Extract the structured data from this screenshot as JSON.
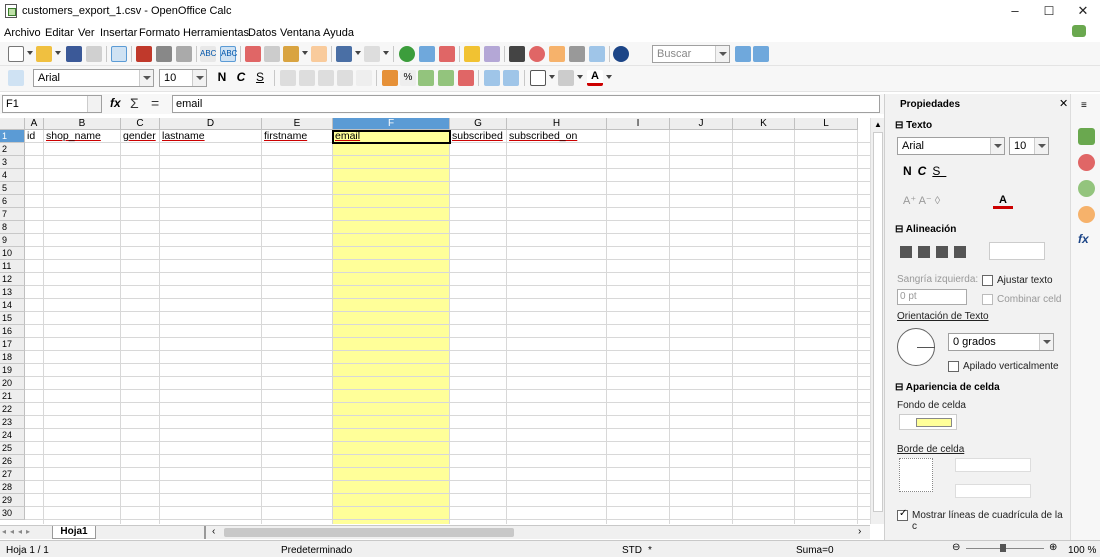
{
  "window": {
    "title": "customers_export_1.csv - OpenOffice Calc",
    "minimize": "–",
    "maximize": "☐",
    "close": "✕"
  },
  "menu": [
    "Archivo",
    "Editar",
    "Ver",
    "Insertar",
    "Formato",
    "Herramientas",
    "Datos",
    "Ventana",
    "Ayuda"
  ],
  "toolbar": {
    "search_placeholder": "Buscar",
    "font_name": "Arial",
    "font_size": "10",
    "bold": "N",
    "italic": "C",
    "underline": "S"
  },
  "formula_bar": {
    "cell_ref": "F1",
    "fx": "fx",
    "sum": "Σ",
    "equals": "=",
    "content": "email"
  },
  "grid": {
    "columns": [
      "A",
      "B",
      "C",
      "D",
      "E",
      "F",
      "G",
      "H",
      "I",
      "J",
      "K",
      "L"
    ],
    "rows": [
      "1",
      "2",
      "3",
      "4",
      "5",
      "6",
      "7",
      "8",
      "9",
      "10",
      "11",
      "12",
      "13",
      "14",
      "15",
      "16",
      "17",
      "18",
      "19",
      "20",
      "21",
      "22",
      "23",
      "24",
      "25",
      "26",
      "27",
      "28",
      "29",
      "30"
    ],
    "row1": [
      "id",
      "shop_name",
      "gender",
      "lastname",
      "firstname",
      "email",
      "subscribed",
      "subscribed_on"
    ]
  },
  "sheet": {
    "tab": "Hoja1"
  },
  "status": {
    "page": "Hoja 1 / 1",
    "style": "Predeterminado",
    "mode": "STD",
    "star": "*",
    "sum": "Suma=0",
    "zoom": "100 %"
  },
  "sidebar": {
    "title": "Propiedades",
    "text_section": "Texto",
    "font_name": "Arial",
    "font_size": "10",
    "align_section": "Alineación",
    "indent_label": "Sangría izquierda:",
    "indent_value": "0 pt",
    "wrap_label": "Ajustar texto",
    "merge_label": "Combinar celd",
    "orientation_label": "Orientación de Texto",
    "orientation_value": "0 grados",
    "stacked_label": "Apilado verticalmente",
    "appearance_section": "Apariencia de celda",
    "bg_label": "Fondo de celda",
    "border_label": "Borde de celda",
    "gridlines_label": "Mostrar líneas de cuadrícula de la c"
  },
  "colors": {
    "highlight": "#ffff99",
    "selected_header": "#5b9bd5"
  }
}
